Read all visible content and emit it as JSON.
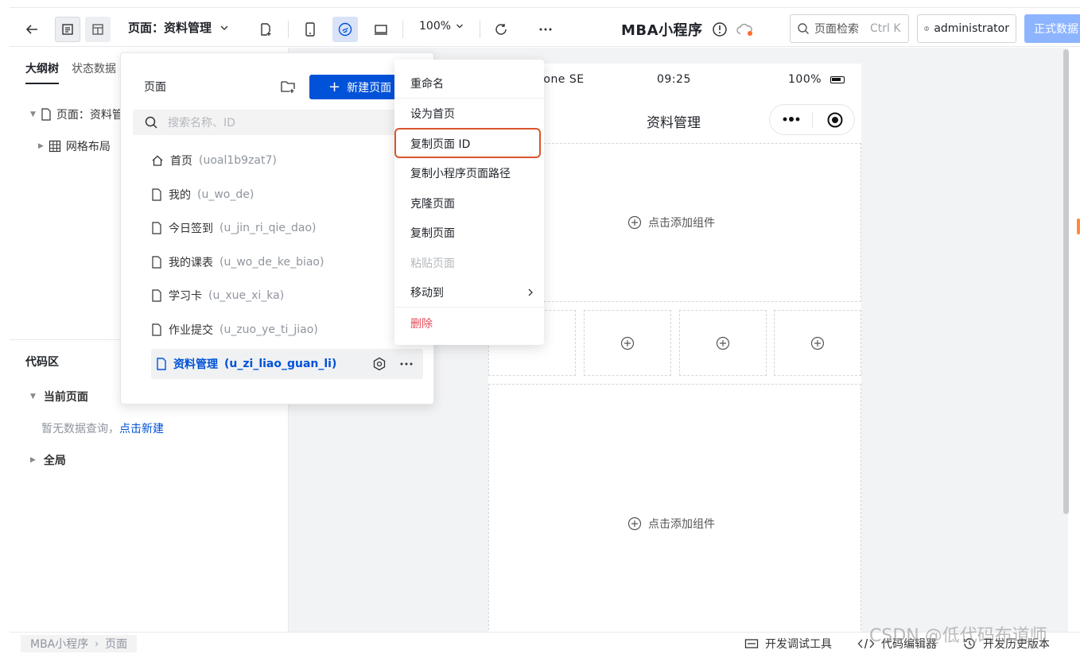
{
  "toolbar": {
    "page_select": "页面：资料管理",
    "zoom": "100%",
    "app_title": "MBA小程序",
    "search_label": "页面检索",
    "search_shortcut": "Ctrl K",
    "user": "administrator",
    "publish_label": "正式数据"
  },
  "left": {
    "tabs": [
      "大纲树",
      "状态数据"
    ],
    "tree": [
      "页面：资料管理",
      "网格布局"
    ],
    "code_title": "代码区",
    "current_page": "当前页面",
    "empty_text": "暂无数据查询，",
    "create_link": "点击新建",
    "global": "全局"
  },
  "page_panel": {
    "title": "页面",
    "new_button": "新建页面",
    "search_placeholder": "搜索名称、ID",
    "pages": [
      {
        "name": "首页",
        "id": "(uoal1b9zat7)",
        "icon": "home-icon"
      },
      {
        "name": "我的",
        "id": "(u_wo_de)",
        "icon": "file-icon"
      },
      {
        "name": "今日签到",
        "id": "(u_jin_ri_qie_dao)",
        "icon": "file-icon"
      },
      {
        "name": "我的课表",
        "id": "(u_wo_de_ke_biao)",
        "icon": "file-icon"
      },
      {
        "name": "学习卡",
        "id": "(u_xue_xi_ka)",
        "icon": "file-icon"
      },
      {
        "name": "作业提交",
        "id": "(u_zuo_ye_ti_jiao)",
        "icon": "file-icon"
      },
      {
        "name": "资料管理",
        "id": "(u_zi_liao_guan_li)",
        "icon": "file-icon"
      }
    ]
  },
  "context_menu": {
    "items": [
      "重命名",
      "设为首页",
      "复制页面 ID",
      "复制小程序页面路径",
      "克隆页面",
      "复制页面",
      "粘贴页面",
      "移动到",
      "删除"
    ]
  },
  "phone": {
    "device": "hone SE",
    "time": "09:25",
    "battery": "100%",
    "page_title": "资料管理",
    "add_component": "点击添加组件"
  },
  "bottom": {
    "crumb_app": "MBA小程序",
    "crumb_page": "页面",
    "debug": "开发调试工具",
    "code_editor": "代码编辑器",
    "history": "开发历史版本"
  },
  "watermark": "CSDN @低代码布道师",
  "colors": {
    "primary": "#0052d9",
    "highlight": "#d9542c",
    "danger": "#e34d59"
  }
}
